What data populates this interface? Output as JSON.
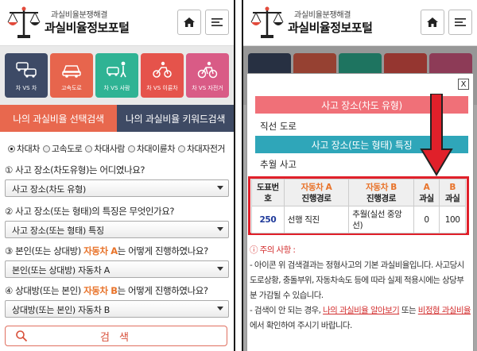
{
  "left": {
    "header": {
      "small_brand": "과실비율분쟁해결",
      "title": "과실비율정보포털"
    },
    "categories": [
      {
        "label": "차 VS 차",
        "color": "#3d4a66"
      },
      {
        "label": "고속도로",
        "color": "#e7654d"
      },
      {
        "label": "차 VS 사람",
        "color": "#2fb394"
      },
      {
        "label": "차 VS 이륜차",
        "color": "#e5534b"
      },
      {
        "label": "차 VS 자전거",
        "color": "#d95b86"
      }
    ],
    "tabs": [
      {
        "label": "나의 과실비율 선택검색"
      },
      {
        "label": "나의 과실비율 키워드검색"
      }
    ],
    "radios": [
      {
        "label": "차대차",
        "checked": true
      },
      {
        "label": "고속도로",
        "checked": false
      },
      {
        "label": "차대사람",
        "checked": false
      },
      {
        "label": "차대이륜차",
        "checked": false
      },
      {
        "label": "차대자전거",
        "checked": false
      }
    ],
    "q1": {
      "text": "① 사고 장소(차도유형)는 어디였나요?",
      "value": "사고 장소(차도 유형)"
    },
    "q2": {
      "text": "② 사고 장소(또는 형태)의 특징은 무엇인가요?",
      "value": "사고 장소(또는 형태) 특징"
    },
    "q3": {
      "pre": "③ 본인(또는 상대방) ",
      "hl": "자동차 A",
      "post": "는 어떻게 진행하였나요?",
      "value": "본인(또는 상대방) 자동차 A"
    },
    "q4": {
      "pre": "④ 상대방(또는 본인) ",
      "hl": "자동차 B",
      "post": "는 어떻게 진행하였나요?",
      "value": "상대방(또는 본인) 자동차 B"
    },
    "search_label": "검 색"
  },
  "right": {
    "header": {
      "small_brand": "과실비율분쟁해결",
      "title": "과실비율정보포털"
    },
    "close_label": "X",
    "bar1": "사고 장소(차도 유형)",
    "bar1_value": "직선 도로",
    "bar2": "사고 장소(또는 형태) 특징",
    "bar2_value": "추월 사고",
    "table": {
      "h_no": "도표번호",
      "h_a_top": "자동차 A",
      "h_a_bot": "진행경로",
      "h_b_top": "자동차 B",
      "h_b_bot": "진행경로",
      "h_fa_top": "A",
      "h_fa_bot": "과실",
      "h_fb_top": "B",
      "h_fb_bot": "과실",
      "row": {
        "no": "250",
        "a": "선행 직진",
        "b": "추월(실선 중앙선)",
        "fa": "0",
        "fb": "100"
      }
    },
    "notice": {
      "title": "주의 사항 :",
      "line1": "- 아이콘 위 검색결과는 정형사고의 기본 과실비율입니다. 사고당시 도로상황, 충돌부위, 자동차속도 등에 따라 실제 적용시에는 상당부분 가감될 수 있습니다.",
      "line2_pre": "- 검색이 안 되는 경우, ",
      "link1": "나의 과실비율 알아보기",
      "line2_mid": " 또는 ",
      "link2": "비정형 과실비율",
      "line2_post": "에서 확인하여 주시기 바랍니다."
    }
  }
}
